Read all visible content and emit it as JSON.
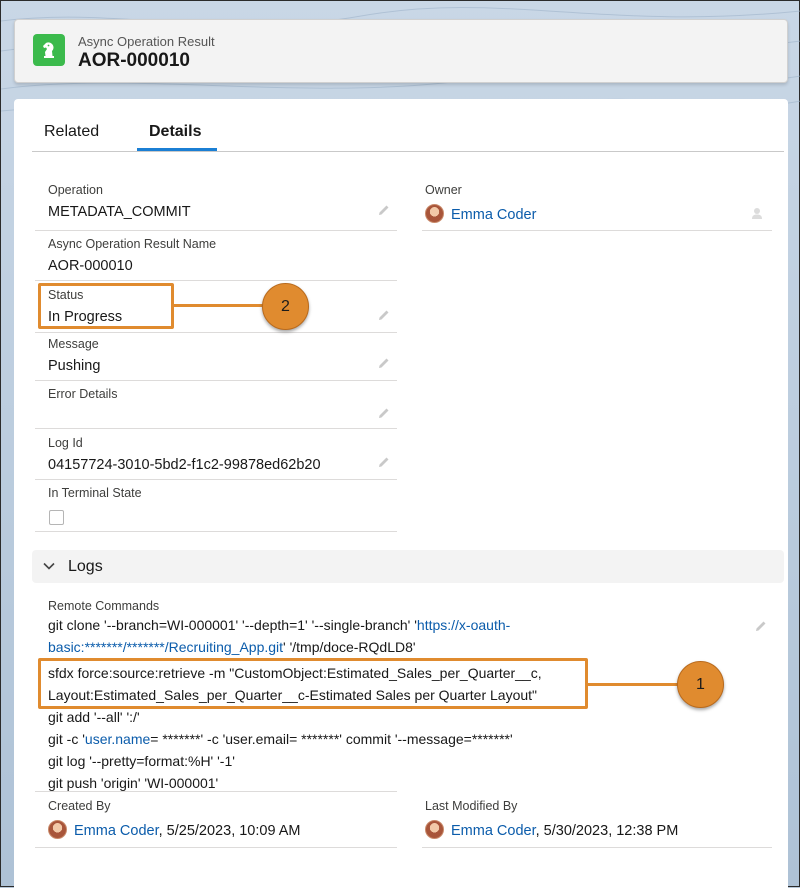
{
  "header": {
    "object_type": "Async Operation Result",
    "record_name": "AOR-000010",
    "icon": "chess-knight-icon",
    "icon_color": "#3bba4c"
  },
  "tabs": [
    {
      "label": "Related",
      "active": false
    },
    {
      "label": "Details",
      "active": true
    }
  ],
  "fields": {
    "operation": {
      "label": "Operation",
      "value": "METADATA_COMMIT"
    },
    "aor_name": {
      "label": "Async Operation Result Name",
      "value": "AOR-000010"
    },
    "status": {
      "label": "Status",
      "value": "In Progress"
    },
    "message": {
      "label": "Message",
      "value": "Pushing"
    },
    "error_details": {
      "label": "Error Details",
      "value": ""
    },
    "log_id": {
      "label": "Log Id",
      "value": "04157724-3010-5bd2-f1c2-99878ed62b20"
    },
    "terminal_state": {
      "label": "In Terminal State",
      "checked": false
    },
    "owner": {
      "label": "Owner",
      "value": "Emma Coder"
    }
  },
  "logs": {
    "section_title": "Logs",
    "remote_commands_label": "Remote Commands",
    "lines": [
      {
        "pre": "git clone '--branch=WI-000001' '--depth=1' '--single-branch' '",
        "link": "https://x-oauth-",
        "post": ""
      },
      {
        "pre": "",
        "link": "basic:*******/*******/Recruiting_App.git",
        "post": "' '/tmp/doce-RQdLD8'"
      },
      {
        "pre": "sfdx force:source:retrieve -m \"CustomObject:Estimated_Sales_per_Quarter__c,",
        "link": "",
        "post": ""
      },
      {
        "pre": "Layout:Estimated_Sales_per_Quarter__c-Estimated Sales per Quarter Layout\"",
        "link": "",
        "post": ""
      },
      {
        "pre": "git add '--all' ':/'",
        "link": "",
        "post": ""
      },
      {
        "pre": "git -c '",
        "link": "user.name",
        "post": "= *******' -c 'user.email= *******' commit '--message=*******'"
      },
      {
        "pre": "git log '--pretty=format:%H' '-1'",
        "link": "",
        "post": ""
      },
      {
        "pre": "git push 'origin' 'WI-000001'",
        "link": "",
        "post": ""
      }
    ]
  },
  "audit": {
    "created_by": {
      "label": "Created By",
      "name": "Emma Coder",
      "date": ", 5/25/2023, 10:09 AM"
    },
    "modified_by": {
      "label": "Last Modified By",
      "name": "Emma Coder",
      "date": ", 5/30/2023, 12:38 PM"
    }
  },
  "callouts": {
    "one": "1",
    "two": "2",
    "color": "#e08b2f"
  }
}
